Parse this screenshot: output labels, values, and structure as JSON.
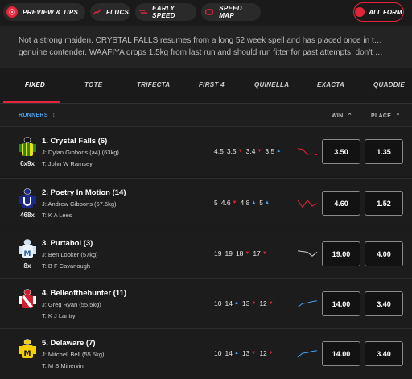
{
  "toolbar": {
    "buttons": [
      {
        "label": "PREVIEW & TIPS",
        "icon": "preview-icon"
      },
      {
        "label": "FLUCS",
        "icon": "chart-line-icon"
      },
      {
        "label": "EARLY SPEED",
        "icon": "speed-icon"
      },
      {
        "label": "SPEED MAP",
        "icon": "speed-map-icon"
      }
    ],
    "all_form": {
      "label": "ALL FORM",
      "icon": "form-icon"
    }
  },
  "comment": {
    "line1": "Not a strong maiden. CRYSTAL FALLS resumes from a long 52 week spell and has placed once in three trials,",
    "line2": "genuine contender. WAAFIYA drops 1.5kg from last run and should run fitter for past attempts, don't treat lightly...."
  },
  "tabs": [
    "FIXED",
    "TOTE",
    "TRIFECTA",
    "FIRST 4",
    "QUINELLA",
    "EXACTA",
    "QUADDIE"
  ],
  "active_tab": "FIXED",
  "header": {
    "runners": "RUNNERS",
    "win": "WIN",
    "place": "PLACE"
  },
  "colors": {
    "accent": "#e3243b",
    "link": "#4b9fe8",
    "background": "#1a1a1a"
  },
  "runners": [
    {
      "name": "1. Crystal Falls (6)",
      "jockey": "J: Dylan Gibbons (a4) (63kg)",
      "trainer": "T: John W Ramsey",
      "form": "6x9x",
      "flucs": [
        {
          "v": "4.5",
          "d": ""
        },
        {
          "v": "3.5",
          "d": "down"
        },
        {
          "v": "3.4",
          "d": "down"
        },
        {
          "v": "3.5",
          "d": "up"
        }
      ],
      "spark": [
        0.3,
        0.35,
        0.75,
        0.7,
        0.78
      ],
      "spark_color": "#e3243b",
      "win": "3.50",
      "place": "1.35",
      "silk": "green-yellow-stripes"
    },
    {
      "name": "2. Poetry In Motion (14)",
      "jockey": "J: Andrew Gibbons (57.5kg)",
      "trainer": "T: K A Lees",
      "form": "468x",
      "flucs": [
        {
          "v": "5",
          "d": ""
        },
        {
          "v": "4.6",
          "d": "down"
        },
        {
          "v": "4.8",
          "d": "up"
        },
        {
          "v": "5",
          "d": "up"
        }
      ],
      "spark": [
        0.3,
        0.85,
        0.3,
        0.75,
        0.55
      ],
      "spark_color": "#e3243b",
      "win": "4.60",
      "place": "1.52",
      "silk": "navy-white-u"
    },
    {
      "name": "3. Purtaboi (3)",
      "jockey": "J: Ben Looker (57kg)",
      "trainer": "T: B F Cavanough",
      "form": "8x",
      "flucs": [
        {
          "v": "19",
          "d": ""
        },
        {
          "v": "19",
          "d": ""
        },
        {
          "v": "18",
          "d": "down"
        },
        {
          "v": "17",
          "d": "down"
        }
      ],
      "spark": [
        0.3,
        0.35,
        0.4,
        0.7,
        0.4
      ],
      "spark_color": "#cfcfcf",
      "win": "19.00",
      "place": "4.00",
      "silk": "white-blue-m"
    },
    {
      "name": "4. Belleofthehunter (11)",
      "jockey": "J: Greg Ryan (55.5kg)",
      "trainer": "T: K J Lantry",
      "form": "",
      "flucs": [
        {
          "v": "10",
          "d": ""
        },
        {
          "v": "14",
          "d": "up"
        },
        {
          "v": "13",
          "d": "down"
        },
        {
          "v": "12",
          "d": "down"
        }
      ],
      "spark": [
        0.8,
        0.5,
        0.45,
        0.35,
        0.3
      ],
      "spark_color": "#4b9fe8",
      "win": "14.00",
      "place": "3.40",
      "silk": "red-white-sash"
    },
    {
      "name": "5. Delaware (7)",
      "jockey": "J: Mitchell Bell (55.5kg)",
      "trainer": "T: M S Minervini",
      "form": "",
      "flucs": [
        {
          "v": "10",
          "d": ""
        },
        {
          "v": "14",
          "d": "up"
        },
        {
          "v": "13",
          "d": "down"
        },
        {
          "v": "12",
          "d": "down"
        }
      ],
      "spark": [
        0.8,
        0.5,
        0.45,
        0.35,
        0.3
      ],
      "spark_color": "#4b9fe8",
      "win": "14.00",
      "place": "3.40",
      "silk": "yellow-black-m"
    }
  ]
}
